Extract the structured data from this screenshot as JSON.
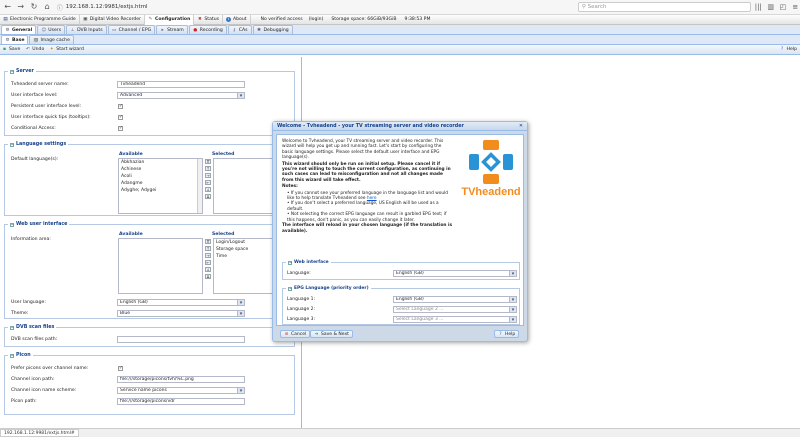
{
  "browser": {
    "url": "192.168.1.12:9981/extjs.html",
    "search_placeholder": "Search"
  },
  "topmenu": {
    "items": [
      "Electronic Programme Guide",
      "Digital Video Recorder",
      "Configuration",
      "Status",
      "About"
    ],
    "active_index": 2,
    "status_user": "No verified access",
    "status_login": "(login)",
    "status_storage": "Storage space: 66GiB/93GiB",
    "status_time": "9:38:53 PM"
  },
  "cfgtabs": [
    "General",
    "Users",
    "DVB Inputs",
    "Channel / EPG",
    "Stream",
    "Recording",
    "CAs",
    "Debugging"
  ],
  "subtabs": [
    "Base",
    "Image cache"
  ],
  "toolbar": {
    "save": "Save",
    "undo": "Undo",
    "wizard": "Start wizard",
    "help": "Help"
  },
  "server": {
    "legend": "Server",
    "name_label": "Tvheadend server name:",
    "name_value": "Tvheadend",
    "level_label": "User interface level:",
    "level_value": "Advanced",
    "persist_label": "Persistent user interface level:",
    "quicktips_label": "User interface quick tips (tooltips):",
    "ca_label": "Conditional Access:"
  },
  "language": {
    "legend": "Language settings",
    "default_label": "Default language(s):",
    "available_hdr": "Available",
    "selected_hdr": "Selected",
    "available": [
      "Abkhazian",
      "Achinese",
      "Acoli",
      "Adangme",
      "Adyghe; Adygei"
    ]
  },
  "webui": {
    "legend": "Web user interface",
    "info_label": "Information area:",
    "available_hdr": "Available",
    "selected_hdr": "Selected",
    "selected": [
      "Login/Logout",
      "Storage space",
      "Time"
    ],
    "lang_label": "User language:",
    "lang_value": "English (GB)",
    "theme_label": "Theme:",
    "theme_value": "Blue"
  },
  "dvbscan": {
    "legend": "DVB scan files",
    "path_label": "DVB scan files path:",
    "path_value": ""
  },
  "picons": {
    "legend": "Picon",
    "prefer_label": "Prefer picons over channel name:",
    "icon_path_label": "Channel icon path:",
    "icon_path_value": "file:///storage/picons/tvh/%C.png",
    "scheme_label": "Channel icon name scheme:",
    "scheme_value": "Service name picons",
    "picon_path_label": "Picon path:",
    "picon_path_value": "file:///storage/picons/vdr"
  },
  "wizard": {
    "title": "Welcome - Tvheadend - your TV streaming server and video recorder",
    "intro": "Welcome to Tvheadend, your TV streaming server and video recorder. This wizard will help you get up and running fast. Let's start by configuring the basic language settings. Please select the default user interface and EPG language(s).",
    "warning": "This wizard should only be run on initial setup. Please cancel it if you're not willing to touch the current configuration, as continuing in such cases can lead to misconfiguration and not all changes made from this wizard will take effect.",
    "notes_title": "Notes:",
    "notes": [
      "If you cannot see your preferred language in the language list and would like to help translate Tvheadend see",
      "If you don't select a preferred language, US English will be used as a default.",
      "Not selecting the correct EPG language can result in garbled EPG text; if this happens, don't panic, as you can easily change it later."
    ],
    "notes_link": "here",
    "reload_note": "The interface will reload in your chosen language (if the translation is available).",
    "logo_text": "TVheadend",
    "webif_legend": "Web interface",
    "webif_lang_label": "Language:",
    "webif_lang_value": "English (GB)",
    "epg_legend": "EPG Language (priority order)",
    "epg_rows": [
      {
        "label": "Language 1:",
        "value": "English (GB)"
      },
      {
        "label": "Language 2:",
        "value": "Select Language 2 ..."
      },
      {
        "label": "Language 3:",
        "value": "Select Language 3 ..."
      }
    ],
    "cancel": "Cancel",
    "save_next": "Save & Next",
    "help": "Help"
  },
  "statusbar": {
    "url": "192.168.1.12:9981/extjs.html#"
  },
  "colors": {
    "accent": "#15428b",
    "panel": "#dfe8f6",
    "border": "#99bbe8",
    "logo_orange": "#f28c1c",
    "logo_blue": "#2a93d5"
  }
}
